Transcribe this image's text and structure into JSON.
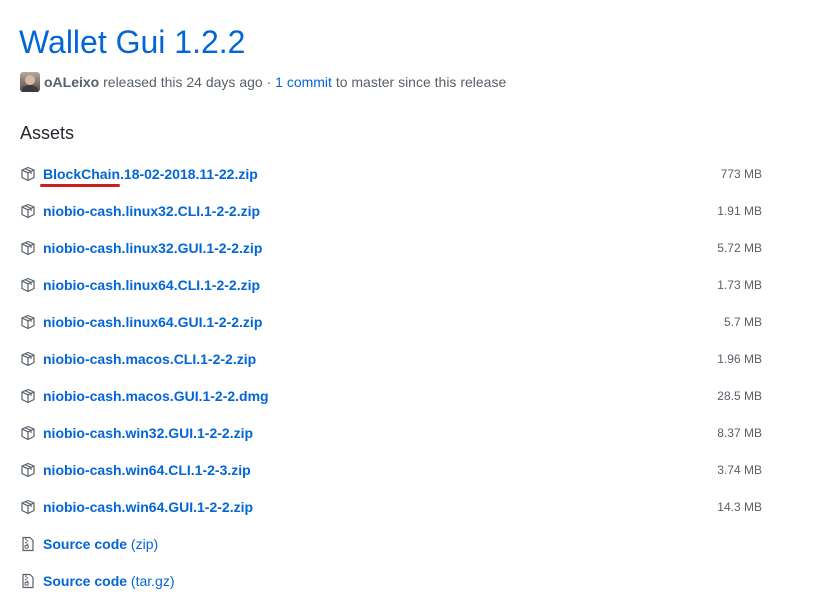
{
  "release": {
    "title": "Wallet Gui 1.2.2",
    "author": "oALeixo",
    "released_text": "released this 24 days ago",
    "separator": "·",
    "commits_link": "1 commit",
    "commits_suffix": "to master since this release"
  },
  "assets": {
    "heading": "Assets",
    "files": [
      {
        "name": "BlockChain.18-02-2018.11-22.zip",
        "size": "773 MB",
        "icon": "package-icon",
        "highlighted": true
      },
      {
        "name": "niobio-cash.linux32.CLI.1-2-2.zip",
        "size": "1.91 MB",
        "icon": "package-icon"
      },
      {
        "name": "niobio-cash.linux32.GUI.1-2-2.zip",
        "size": "5.72 MB",
        "icon": "package-icon"
      },
      {
        "name": "niobio-cash.linux64.CLI.1-2-2.zip",
        "size": "1.73 MB",
        "icon": "package-icon"
      },
      {
        "name": "niobio-cash.linux64.GUI.1-2-2.zip",
        "size": "5.7 MB",
        "icon": "package-icon"
      },
      {
        "name": "niobio-cash.macos.CLI.1-2-2.zip",
        "size": "1.96 MB",
        "icon": "package-icon"
      },
      {
        "name": "niobio-cash.macos.GUI.1-2-2.dmg",
        "size": "28.5 MB",
        "icon": "package-icon"
      },
      {
        "name": "niobio-cash.win32.GUI.1-2-2.zip",
        "size": "8.37 MB",
        "icon": "package-icon"
      },
      {
        "name": "niobio-cash.win64.CLI.1-2-3.zip",
        "size": "3.74 MB",
        "icon": "package-icon"
      },
      {
        "name": "niobio-cash.win64.GUI.1-2-2.zip",
        "size": "14.3 MB",
        "icon": "package-icon"
      }
    ],
    "sources": [
      {
        "label": "Source code",
        "suffix": "(zip)",
        "icon": "file-zip-icon"
      },
      {
        "label": "Source code",
        "suffix": "(tar.gz)",
        "icon": "file-zip-icon"
      }
    ]
  },
  "colors": {
    "link": "#0366d6",
    "muted": "#586069",
    "text": "#24292e",
    "annotation": "#cc1f1f"
  }
}
